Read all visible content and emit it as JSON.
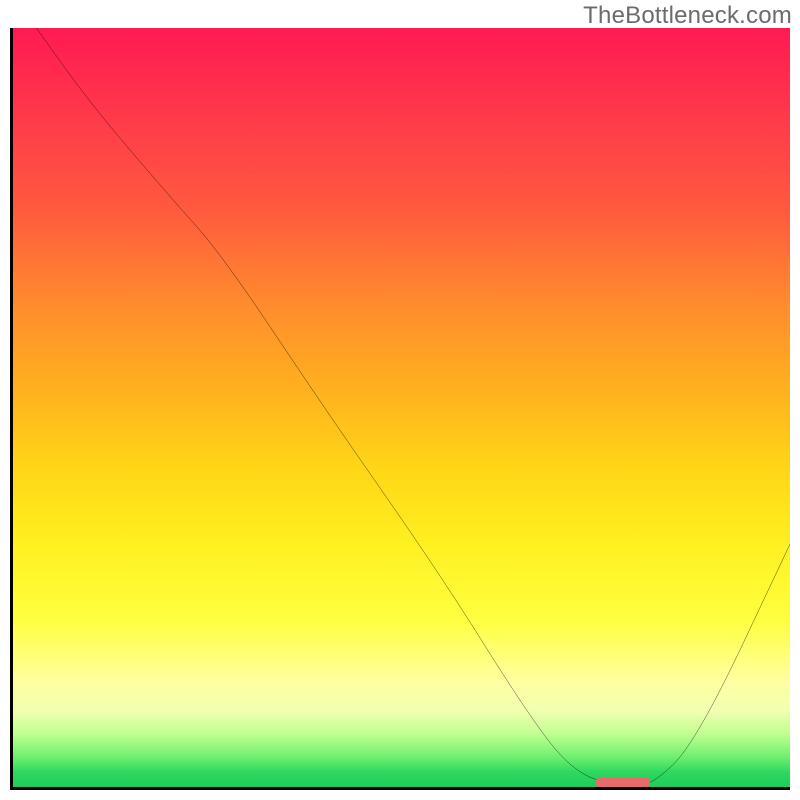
{
  "attribution": "TheBottleneck.com",
  "chart_data": {
    "type": "line",
    "title": "",
    "xlabel": "",
    "ylabel": "",
    "x_range": [
      0,
      100
    ],
    "y_range": [
      0,
      100
    ],
    "grid": false,
    "series": [
      {
        "name": "bottleneck-curve",
        "x": [
          3,
          10,
          20,
          27,
          40,
          55,
          66,
          72,
          78,
          82,
          88,
          100
        ],
        "y": [
          100,
          90,
          78,
          70,
          50,
          28,
          10,
          2,
          0,
          0,
          6,
          32
        ],
        "color": "#000000"
      }
    ],
    "marker": {
      "x_start": 75,
      "x_end": 82,
      "y": 0.6,
      "color": "#e86a6a"
    },
    "gradient_stops": [
      {
        "pct": 0,
        "color": "#ff1a52"
      },
      {
        "pct": 12,
        "color": "#ff3a4a"
      },
      {
        "pct": 24,
        "color": "#ff5a3e"
      },
      {
        "pct": 36,
        "color": "#ff8a2e"
      },
      {
        "pct": 48,
        "color": "#ffb21e"
      },
      {
        "pct": 58,
        "color": "#ffd616"
      },
      {
        "pct": 68,
        "color": "#fff020"
      },
      {
        "pct": 78,
        "color": "#ffff40"
      },
      {
        "pct": 86,
        "color": "#ffffa0"
      },
      {
        "pct": 90,
        "color": "#f0ffb0"
      },
      {
        "pct": 93,
        "color": "#c0ff90"
      },
      {
        "pct": 96,
        "color": "#70f070"
      },
      {
        "pct": 98,
        "color": "#30d860"
      },
      {
        "pct": 100,
        "color": "#1ecc5a"
      }
    ]
  }
}
